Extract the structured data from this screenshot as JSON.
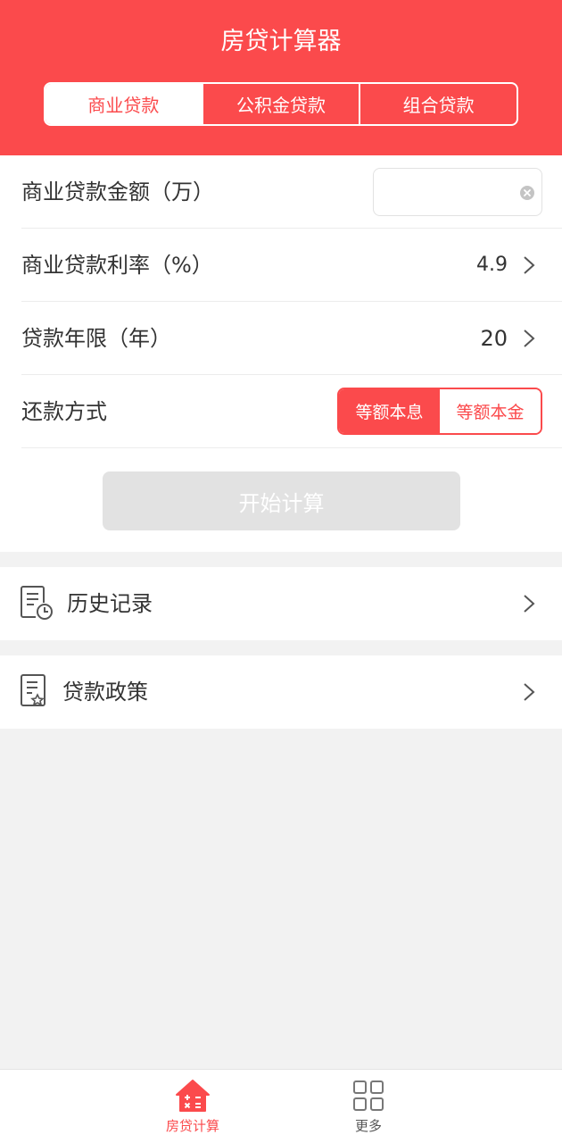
{
  "colors": {
    "accent": "#fb4a4c",
    "disabled_button": "#e2e2e2",
    "background": "#f2f2f2"
  },
  "header": {
    "title": "房贷计算器",
    "tabs": [
      {
        "label": "商业贷款",
        "active": true
      },
      {
        "label": "公积金贷款",
        "active": false
      },
      {
        "label": "组合贷款",
        "active": false
      }
    ]
  },
  "form": {
    "amount": {
      "label": "商业贷款金额（万）",
      "value": "",
      "placeholder": ""
    },
    "rate": {
      "label": "商业贷款利率（%）",
      "value": "4.9"
    },
    "years": {
      "label": "贷款年限（年）",
      "value": "20"
    },
    "repayment": {
      "label": "还款方式",
      "options": [
        {
          "label": "等额本息",
          "active": true
        },
        {
          "label": "等额本金",
          "active": false
        }
      ]
    },
    "calculate_label": "开始计算"
  },
  "menu": [
    {
      "label": "历史记录",
      "icon": "history-icon"
    },
    {
      "label": "贷款政策",
      "icon": "policy-icon"
    }
  ],
  "tabbar": [
    {
      "label": "房贷计算",
      "icon": "house-calculator-icon",
      "active": true
    },
    {
      "label": "更多",
      "icon": "grid-icon",
      "active": false
    }
  ]
}
